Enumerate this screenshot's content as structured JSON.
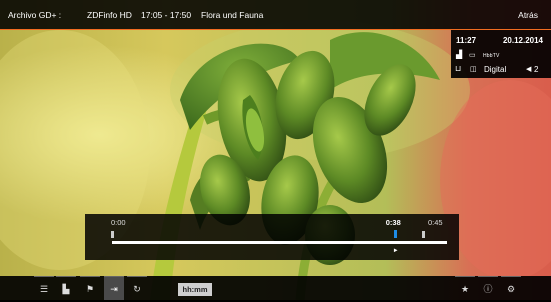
{
  "topbar": {
    "source": "Archivo GD+ :",
    "channel": "ZDFinfo HD",
    "time": "17:05 - 17:50",
    "title": "Flora und Fauna",
    "back_label": "Atrás"
  },
  "infobox": {
    "clock": "11:27",
    "date": "20.12.2014",
    "icons": {
      "signal": "signal-icon",
      "subtitle": "subtitle-icon",
      "hbbtv": "HbbTV",
      "record": "record-icon",
      "dolby": "dolby-icon",
      "audio": "audio-icon"
    },
    "audio_format": "Digital",
    "audio_track": "2"
  },
  "progress": {
    "start": "0:00",
    "current": "0:38",
    "end": "0:45",
    "position_fraction": 0.844,
    "play_glyph": "►"
  },
  "bottombar": {
    "time_input_placeholder": "hh:mm",
    "icons": [
      "list-icon",
      "subtitle-icon",
      "chapter-icon",
      "skip-icon",
      "repeat-icon",
      "favorite-icon",
      "info-icon",
      "settings-icon"
    ],
    "glyphs": {
      "list": "☰",
      "subtitle": "▙",
      "chapter": "⚑",
      "skip": "⇥",
      "repeat": "↻",
      "favorite": "★",
      "info": "ⓘ",
      "settings": "⚙"
    }
  },
  "colors": {
    "accent": "#f26d21",
    "progress_marker": "#1e8ce6",
    "active_button": "#4a4a4a"
  }
}
